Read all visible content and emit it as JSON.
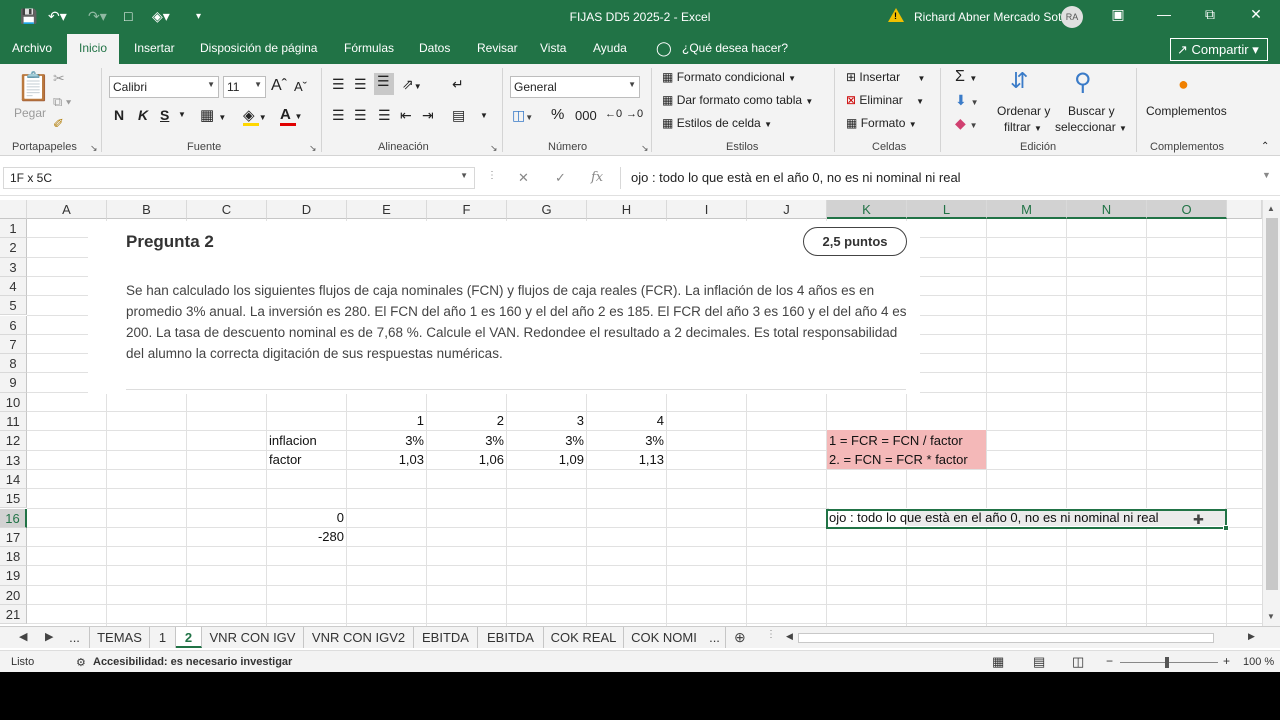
{
  "titlebar": {
    "title": "FIJAS DD5 2025-2  -  Excel",
    "user": "Richard Abner Mercado Soto",
    "avatar": "RA",
    "icons": [
      "save-icon",
      "undo-icon",
      "redo-icon",
      "new-file-icon",
      "fill-color-icon",
      "customize-icon",
      "warning-icon",
      "ribbon-display-icon",
      "minimize-icon",
      "restore-icon",
      "close-icon"
    ]
  },
  "menu": {
    "tabs": [
      "Archivo",
      "Inicio",
      "Insertar",
      "Disposición de página",
      "Fórmulas",
      "Datos",
      "Revisar",
      "Vista",
      "Ayuda"
    ],
    "tell_me": "¿Qué desea hacer?",
    "share": "Compartir"
  },
  "ribbon": {
    "clipboard": {
      "paste": "Pegar",
      "label": "Portapapeles"
    },
    "font": {
      "name": "Calibri",
      "size": "11",
      "bold": "N",
      "italic": "K",
      "strike": "S",
      "underline": "S",
      "label": "Fuente"
    },
    "alignment": {
      "label": "Alineación"
    },
    "number": {
      "format": "General",
      "label": "Número"
    },
    "styles": {
      "conditional": "Formato condicional",
      "as_table": "Dar formato como tabla",
      "cell_styles": "Estilos de celda",
      "label": "Estilos"
    },
    "cells": {
      "insert": "Insertar",
      "delete": "Eliminar",
      "format": "Formato",
      "label": "Celdas"
    },
    "editing": {
      "sort": "Ordenar y",
      "sort2": "filtrar",
      "find": "Buscar y",
      "find2": "seleccionar",
      "label": "Edición"
    },
    "addins": {
      "button": "Complementos",
      "label": "Complementos"
    }
  },
  "formula_bar": {
    "name_box": "1F x 5C",
    "formula": "ojo : todo lo que està en el año 0, no es ni nominal ni real"
  },
  "columns": [
    "A",
    "B",
    "C",
    "D",
    "E",
    "F",
    "G",
    "H",
    "I",
    "J",
    "K",
    "L",
    "M",
    "N",
    "O"
  ],
  "rows": [
    "1",
    "2",
    "3",
    "4",
    "5",
    "6",
    "7",
    "8",
    "9",
    "10",
    "11",
    "12",
    "13",
    "14",
    "15",
    "16",
    "17",
    "18",
    "19",
    "20",
    "21"
  ],
  "picture": {
    "title": "Pregunta 2",
    "points": "2,5 puntos",
    "body": "Se han calculado los siguientes flujos de caja nominales (FCN) y flujos de caja reales (FCR). La inflación de los 4 años es en promedio 3% anual. La inversión es 280. El FCN del año 1 es 160 y el del año 2 es 185. El FCR del año 3 es 160 y el del año 4 es 200. La tasa de descuento nominal es de 7,68 %. Calcule el VAN. Redondee el resultado a 2 decimales. Es total responsabilidad del alumno la correcta digitación de sus respuestas numéricas."
  },
  "cells": {
    "E11": "1",
    "F11": "2",
    "G11": "3",
    "H11": "4",
    "D12": "inflacion",
    "E12": "3%",
    "F12": "3%",
    "G12": "3%",
    "H12": "3%",
    "D13": "factor",
    "E13": "1,03",
    "F13": "1,06",
    "G13": "1,09",
    "H13": "1,13",
    "K12": "1 = FCR = FCN / factor",
    "K13": "2. = FCN = FCR * factor",
    "D16": "0",
    "D17": "-280",
    "K16": "ojo : todo lo que està en el año 0, no es ni nominal ni real"
  },
  "sheet_tabs": [
    "...",
    "TEMAS",
    "1",
    "2",
    "VNR CON IGV",
    "VNR CON IGV2",
    "EBITDA",
    "EBITDA",
    "COK REAL",
    "COK NOMI",
    "..."
  ],
  "status": {
    "ready": "Listo",
    "accessibility": "Accesibilidad: es necesario investigar",
    "zoom": "100 %"
  },
  "colors": {
    "excel_green": "#217346",
    "note_fill": "#f4b8b8"
  }
}
